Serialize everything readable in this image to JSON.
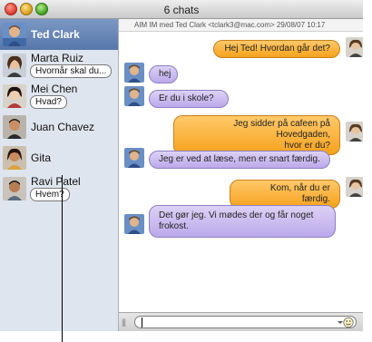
{
  "window": {
    "title": "6 chats"
  },
  "sidebar": {
    "contacts": [
      {
        "name": "Ted Clark",
        "preview": "",
        "selected": true
      },
      {
        "name": "Marta Ruiz",
        "preview": "Hvornår skal du..."
      },
      {
        "name": "Mei Chen",
        "preview": "Hvad?"
      },
      {
        "name": "Juan Chavez",
        "preview": ""
      },
      {
        "name": "Gita",
        "preview": ""
      },
      {
        "name": "Ravi Patel",
        "preview": "Hvem?"
      }
    ]
  },
  "chat": {
    "header": "AIM IM med Ted Clark <tclark3@mac.com> 29/08/07 10:17",
    "messages": [
      {
        "direction": "out",
        "text": "Hej Ted! Hvordan går det?"
      },
      {
        "direction": "in",
        "text": "hej"
      },
      {
        "direction": "in",
        "text": "Er du i skole?"
      },
      {
        "direction": "out",
        "line1": "Jeg sidder på cafeen på Hovedgaden,",
        "line2": "hvor er du?"
      },
      {
        "direction": "in",
        "text": "Jeg er ved at læse, men er snart færdig."
      },
      {
        "direction": "out",
        "text": "Kom, når du er færdig."
      },
      {
        "direction": "in",
        "line1": "Det gør jeg. Vi mødes der og får noget",
        "line2": "frokost."
      }
    ]
  },
  "input": {
    "value": "",
    "smiley_icon": "smiley-face-icon",
    "grip_icon": "resize-grip-icon"
  },
  "colors": {
    "sidebar_bg": "#dfe5ee",
    "selection": "#6382b6",
    "outgoing_bubble": "#f6a21c",
    "incoming_bubble": "#bba9ea"
  }
}
